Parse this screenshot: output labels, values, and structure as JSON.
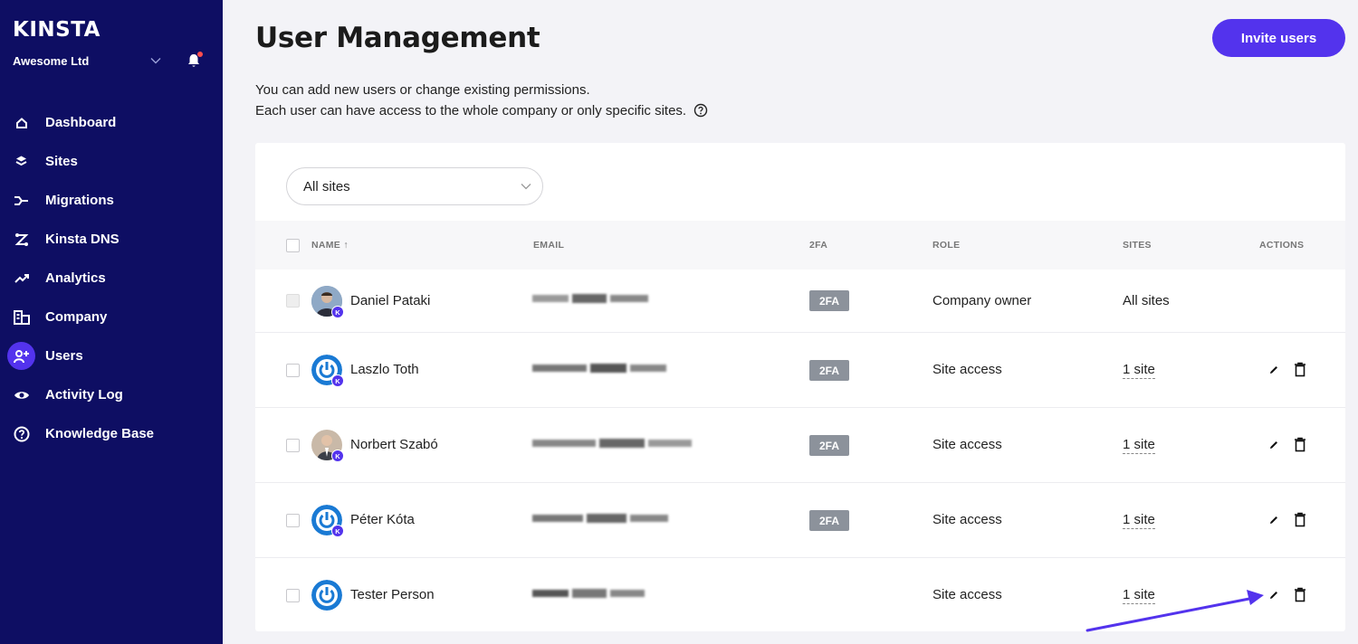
{
  "brand": {
    "logo": "KINSTA",
    "accent": "#5333ed",
    "sidebar_bg": "#0e0e63"
  },
  "sidebar": {
    "company": "Awesome Ltd",
    "items": [
      {
        "label": "Dashboard",
        "icon": "home-icon"
      },
      {
        "label": "Sites",
        "icon": "layers-icon"
      },
      {
        "label": "Migrations",
        "icon": "migrations-icon"
      },
      {
        "label": "Kinsta DNS",
        "icon": "dns-icon"
      },
      {
        "label": "Analytics",
        "icon": "analytics-icon"
      },
      {
        "label": "Company",
        "icon": "company-icon"
      },
      {
        "label": "Users",
        "icon": "user-add-icon",
        "active": true
      },
      {
        "label": "Activity Log",
        "icon": "eye-icon"
      },
      {
        "label": "Knowledge Base",
        "icon": "help-icon"
      }
    ]
  },
  "header": {
    "title": "User Management",
    "invite_label": "Invite users",
    "desc_line1": "You can add new users or change existing permissions.",
    "desc_line2": "Each user can have access to the whole company or only specific sites."
  },
  "filter": {
    "value": "All sites"
  },
  "table": {
    "columns": {
      "name": "NAME ↑",
      "email": "EMAIL",
      "tfa": "2FA",
      "role": "ROLE",
      "sites": "SITES",
      "actions": "ACTIONS"
    },
    "rows": [
      {
        "name": "Daniel Pataki",
        "avatar": "photo",
        "tfa": "2FA",
        "role": "Company owner",
        "sites": "All sites",
        "actions": false
      },
      {
        "name": "Laszlo Toth",
        "avatar": "power",
        "tfa": "2FA",
        "role": "Site access",
        "sites": "1 site",
        "actions": true
      },
      {
        "name": "Norbert Szabó",
        "avatar": "photo",
        "tfa": "2FA",
        "role": "Site access",
        "sites": "1 site",
        "actions": true
      },
      {
        "name": "Péter Kóta",
        "avatar": "power",
        "tfa": "2FA",
        "role": "Site access",
        "sites": "1 site",
        "actions": true
      },
      {
        "name": "Tester Person",
        "avatar": "power",
        "tfa": "",
        "role": "Site access",
        "sites": "1 site",
        "actions": true
      }
    ]
  }
}
